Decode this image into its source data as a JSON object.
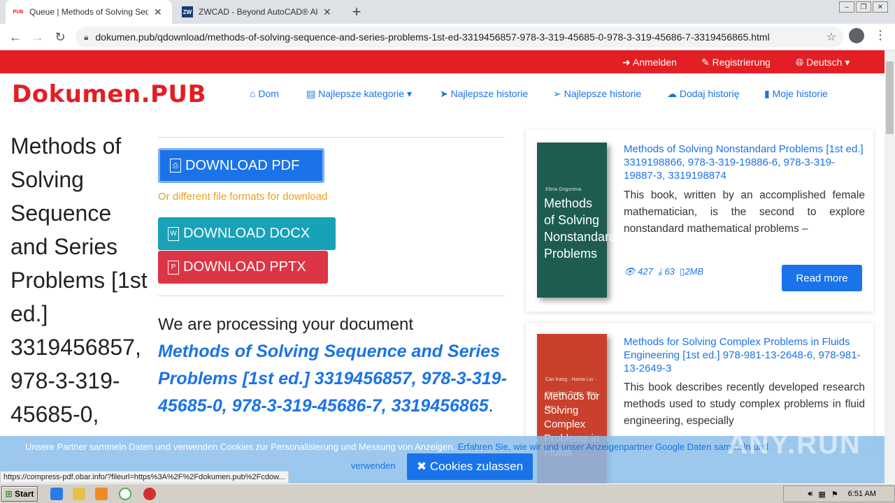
{
  "browser": {
    "tabs": [
      {
        "favicon": "PUB",
        "title": "Queue | Methods of Solving Sequence"
      },
      {
        "favicon": "ZW",
        "title": "ZWCAD - Beyond AutoCAD® Alterna"
      }
    ],
    "url": "dokumen.pub/qdownload/methods-of-solving-sequence-and-series-problems-1st-ed-3319456857-978-3-319-45685-0-978-3-319-45686-7-3319456865.html",
    "status_url": "https://compress-pdf.obar.info/?fileurl=https%3A%2F%2Fdokumen.pub%2Fcdow..."
  },
  "topbar": {
    "login": "Anmelden",
    "register": "Registrierung",
    "language": "Deutsch"
  },
  "header": {
    "logo": "Dokumen.PUB",
    "nav": [
      "Dom",
      "Najlepsze kategorie",
      "Najlepsze historie",
      "Najlepsze historie",
      "Dodaj historię",
      "Moje historie"
    ]
  },
  "main": {
    "title": "Methods of Solving Sequence and Series Problems [1st ed.] 3319456857, 978-3-319-45685-0,",
    "download_pdf": "DOWNLOAD PDF",
    "other_formats": "Or different file formats for download",
    "download_docx": "DOWNLOAD DOCX",
    "download_pptx": "DOWNLOAD PPTX",
    "processing_text": "We are processing your document",
    "processing_title": "Methods of Solving Sequence and Series Problems [1st ed.] 3319456857, 978-3-319-45685-0, 978-3-319-45686-7, 3319456865",
    "processing_end": "."
  },
  "sidebar": {
    "cards": [
      {
        "cover_small": "Ellina Grigorieva",
        "cover_title": "Methods of Solving Nonstandard Problems",
        "title": "Methods of Solving Nonstandard Problems [1st ed.] 3319198866, 978-3-319-19886-6, 978-3-319-19887-3, 3319198874",
        "desc": "This book, written by an accomplished female mathematician, is the second to explore nonstandard mathematical problems –",
        "views": "427",
        "downloads": "63",
        "size": "2MB",
        "read_more": "Read more"
      },
      {
        "cover_small": "Can Kang · Haixia Liu · Yongchao Zhang · Ning Mao",
        "cover_title": "Methods for Solving Complex Problems in Fluids",
        "title": "Methods for Solving Complex Problems in Fluids Engineering [1st ed.] 978-981-13-2648-6, 978-981-13-2649-3",
        "desc": "This book describes recently developed research methods used to study complex problems in fluid engineering, especially"
      }
    ]
  },
  "cookie": {
    "text": "Unsere Partner sammeln Daten und verwenden Cookies zur Personalisierung und Messung von Anzeigen.",
    "link": "Erfahren Sie, wie wir und unser Anzeigenpartner Google Daten sammeln und",
    "link2": "verwenden",
    "button": "Cookies zulassen"
  },
  "watermark": "ANY.RUN",
  "taskbar": {
    "start": "Start",
    "clock": "6:51 AM"
  }
}
